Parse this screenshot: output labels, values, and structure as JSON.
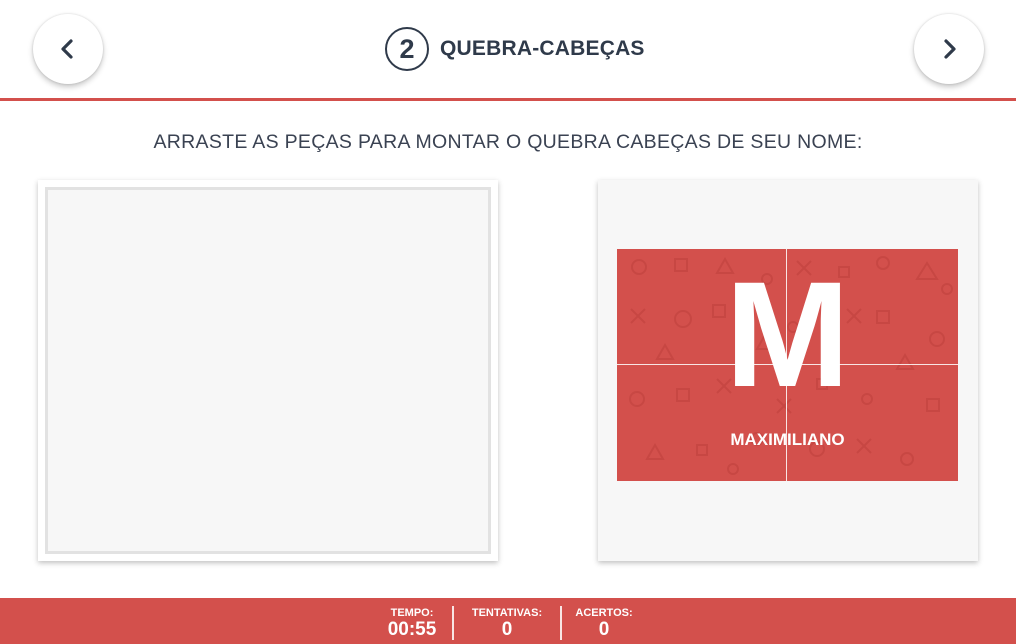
{
  "header": {
    "step_number": "2",
    "step_title": "QUEBRA-CABEÇAS",
    "prev_icon": "chevron-left-icon",
    "next_icon": "chevron-right-icon"
  },
  "instruction": "ARRASTE AS PEÇAS PARA MONTAR O QUEBRA CABEÇAS DE SEU NOME:",
  "puzzle": {
    "letter": "M",
    "name": "MAXIMILIANO",
    "pieces": 4
  },
  "footer": {
    "time_label": "TEMPO:",
    "time_value": "00:55",
    "tries_label": "TENTATIVAS:",
    "tries_value": "0",
    "hits_label": "ACERTOS:",
    "hits_value": "0"
  },
  "colors": {
    "accent": "#d3504c",
    "text_dark": "#2f3a4a",
    "board_bg": "#f7f7f7"
  }
}
